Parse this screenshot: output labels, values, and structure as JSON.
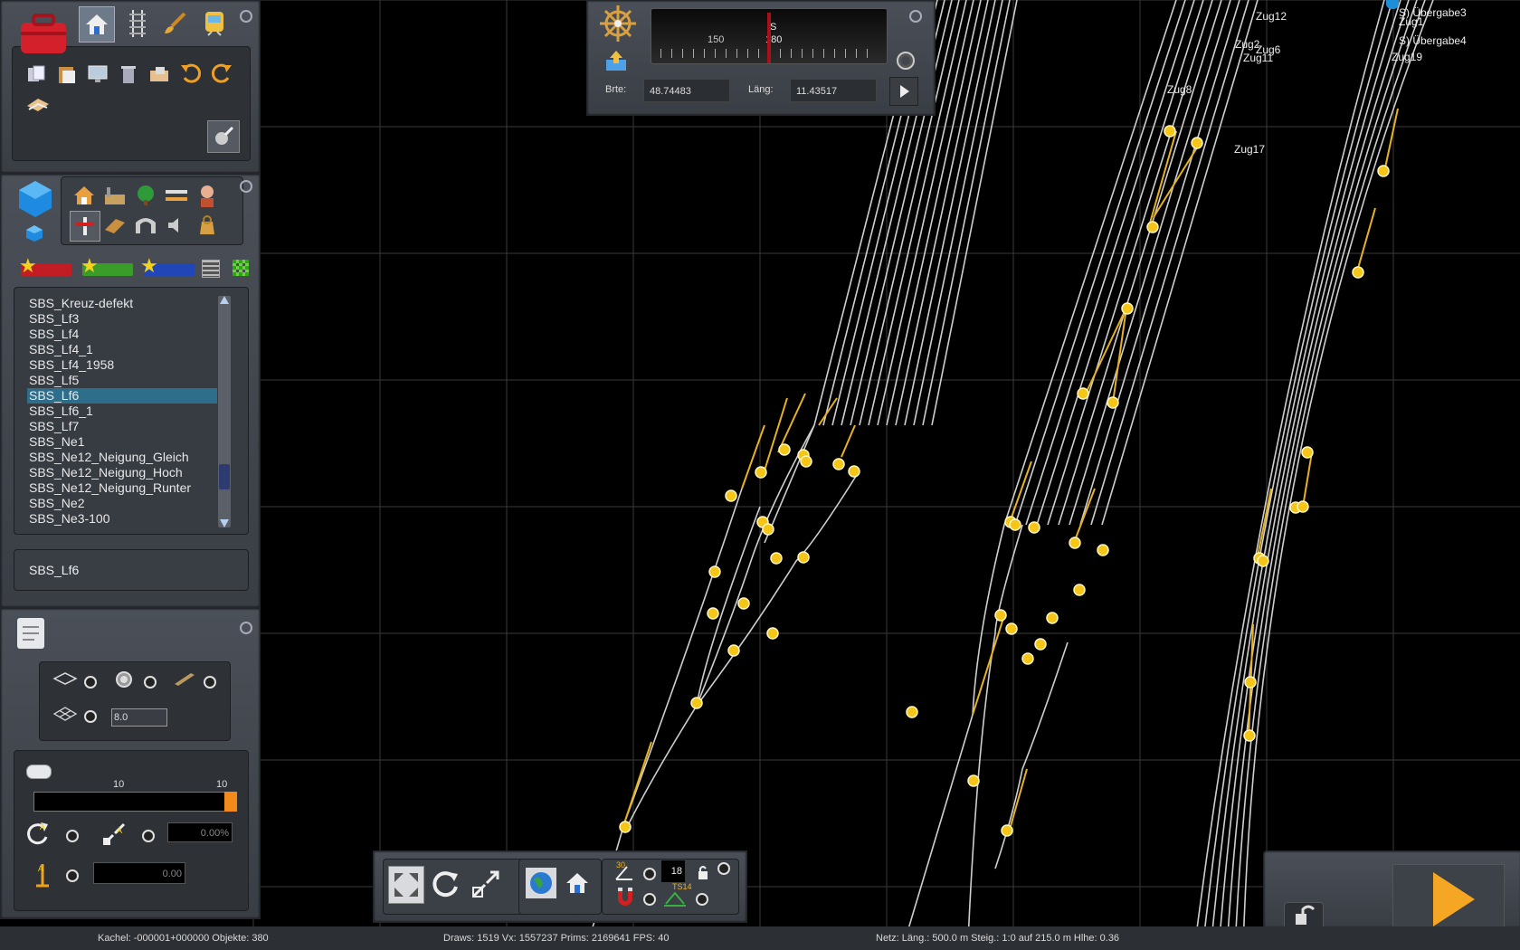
{
  "toolbar_top": {
    "icons": [
      "toolbox-icon",
      "home-icon",
      "track-icon",
      "brush-icon",
      "train-icon",
      "copy-icon",
      "paste-icon",
      "monitor-icon",
      "trash-icon",
      "eraser-icon",
      "undo-icon",
      "redo-icon",
      "hand-tool-icon",
      "camera-icon"
    ]
  },
  "compass": {
    "heading_label": "S",
    "scale_left": "150",
    "scale_right": "180",
    "lat_label": "Brte:",
    "lat_value": "48.74483",
    "lon_label": "Läng:",
    "lon_value": "11.43517"
  },
  "asset_browser": {
    "categories": [
      "house-icon",
      "factory-icon",
      "tree-icon",
      "bridge-icon",
      "person-icon",
      "signal-icon",
      "rails-icon",
      "tunnel-icon",
      "speaker-icon",
      "bag-icon"
    ],
    "items": [
      "SBS_Kreuz-defekt",
      "SBS_Lf3",
      "SBS_Lf4",
      "SBS_Lf4_1",
      "SBS_Lf4_1958",
      "SBS_Lf5",
      "SBS_Lf6",
      "SBS_Lf6_1",
      "SBS_Lf7",
      "SBS_Ne1",
      "SBS_Ne12_Neigung_Gleich",
      "SBS_Ne12_Neigung_Hoch",
      "SBS_Ne12_Neigung_Runter",
      "SBS_Ne2",
      "SBS_Ne3-100"
    ],
    "selected_index": 6,
    "selected_name": "SBS_Lf6"
  },
  "properties": {
    "height_value": "8.0",
    "slider_min": "10",
    "slider_max": "10",
    "percent_value": "0.00%",
    "height_offset_value": "0.00"
  },
  "bottom_toolbar": {
    "counter": "18",
    "badge_a": "30",
    "badge_b": "TS14"
  },
  "status": {
    "tile": "Kachel: -000001+000000  Objekte: 380",
    "draws": "Draws: 1519 Vx: 1557237 Prims: 2169641 FPS: 40",
    "net": "Netz: Läng.:  500.0 m Steig.: 1:0 auf 215.0 m Hlhe:  0.36"
  },
  "trains": [
    "Zug12",
    "Zug1",
    "Zug2",
    "Zug6",
    "Zug11",
    "Zug8",
    "Zug17",
    "Zug19"
  ],
  "marks": [
    "S) Übergabe3",
    "S) Übergabe4"
  ],
  "colors": {
    "panel": "#454a52",
    "track": "#d0d0d0",
    "junction": "#f5c518",
    "selection": "#2e6e8a",
    "play": "#f5a623"
  }
}
